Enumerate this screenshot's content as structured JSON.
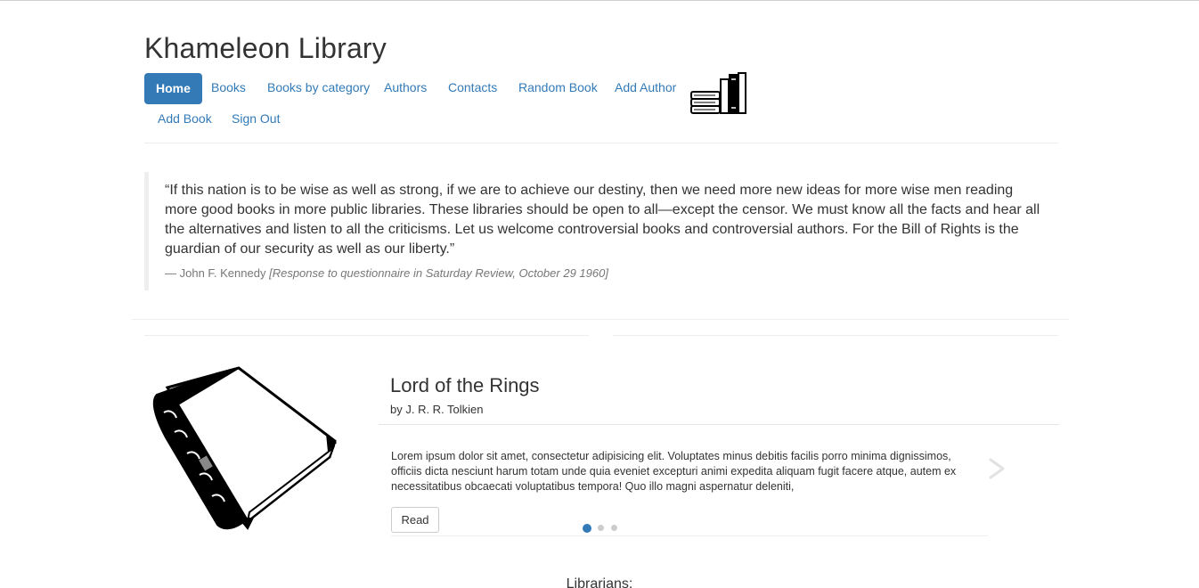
{
  "site": {
    "title": "Khameleon Library"
  },
  "nav": {
    "items": [
      {
        "label": "Home",
        "active": true
      },
      {
        "label": "Books"
      },
      {
        "label": "Books by category"
      },
      {
        "label": "Authors"
      },
      {
        "label": "Contacts"
      },
      {
        "label": "Random Book"
      },
      {
        "label": "Add Author"
      },
      {
        "label": "Add Book"
      },
      {
        "label": "Sign Out"
      }
    ],
    "logo_icon": "books-stack-icon"
  },
  "quote": {
    "text": "“If this nation is to be wise as well as strong, if we are to achieve our destiny, then we need more new ideas for more wise men reading more good books in more public libraries. These libraries should be open to all—except the censor. We must know all the facts and hear all the alternatives and listen to all the criticisms. Let us welcome controversial books and controversial authors. For the Bill of Rights is the guardian of our security as well as our liberty.”",
    "author": "— John F. Kennedy",
    "source": "[Response to questionnaire in Saturday Review, October 29 1960]"
  },
  "carousel": {
    "book": {
      "title": "Lord of the Rings",
      "author": "by J. R. R. Tolkien",
      "description": "Lorem ipsum dolor sit amet, consectetur adipisicing elit. Voluptates minus debitis facilis porro minima dignissimos, officiis dicta nesciunt harum totam unde quia eveniet excepturi animi expedita aliquam fugit facere atque, autem ex necessitatibus obcaecati voluptatibus tempora! Quo illo magni aspernatur deleniti,",
      "read_label": "Read",
      "image_icon": "book-icon"
    },
    "slides": 3,
    "active_slide": 1,
    "next_icon": "chevron-right-icon"
  },
  "librarians": {
    "heading": "Librarians:"
  },
  "colors": {
    "accent": "#337ab7",
    "text": "#333333",
    "muted": "#777777"
  }
}
